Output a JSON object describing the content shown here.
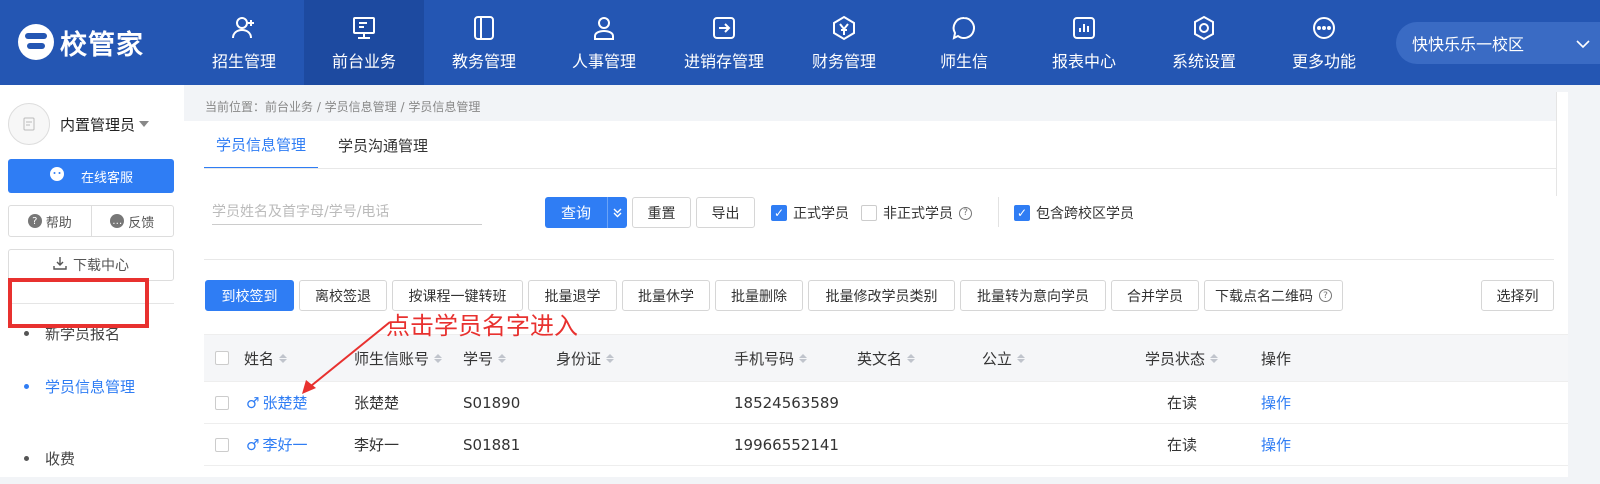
{
  "app": {
    "logo_text": "校管家"
  },
  "nav": {
    "items": [
      {
        "label": "招生管理",
        "icon": "user-add-icon"
      },
      {
        "label": "前台业务",
        "icon": "desk-icon",
        "active": true
      },
      {
        "label": "教务管理",
        "icon": "book-icon"
      },
      {
        "label": "人事管理",
        "icon": "person-icon"
      },
      {
        "label": "进销存管理",
        "icon": "inventory-icon"
      },
      {
        "label": "财务管理",
        "icon": "finance-icon"
      },
      {
        "label": "师生信",
        "icon": "message-icon"
      },
      {
        "label": "报表中心",
        "icon": "report-icon"
      },
      {
        "label": "系统设置",
        "icon": "settings-icon"
      },
      {
        "label": "更多功能",
        "icon": "more-icon"
      }
    ],
    "campus": "快快乐乐一校区"
  },
  "sidebar": {
    "username": "内置管理员",
    "service": "在线客服",
    "help": "帮助",
    "feedback": "反馈",
    "download": "下载中心",
    "items": [
      {
        "label": "新学员报名"
      },
      {
        "label": "学员信息管理",
        "active": true
      },
      {
        "label": "收费"
      }
    ]
  },
  "breadcrumb": "当前位置：前台业务 / 学员信息管理 / 学员信息管理",
  "tabs": [
    "学员信息管理",
    "学员沟通管理"
  ],
  "filter": {
    "search_placeholder": "学员姓名及首字母/学号/电话",
    "query": "查询",
    "reset": "重置",
    "export": "导出",
    "formal": "正式学员",
    "informal": "非正式学员",
    "cross_campus": "包含跨校区学员"
  },
  "actions": [
    "到校签到",
    "离校签退",
    "按课程一键转班",
    "批量退学",
    "批量休学",
    "批量删除",
    "批量修改学员类别",
    "批量转为意向学员",
    "合并学员",
    "下载点名二维码"
  ],
  "select_columns": "选择列",
  "table": {
    "headers": [
      "姓名",
      "师生信账号",
      "学号",
      "身份证",
      "手机号码",
      "英文名",
      "公立",
      "学员状态",
      "操作"
    ],
    "rows": [
      {
        "gender": "♂",
        "name": "张楚楚",
        "account": "张楚楚",
        "id": "S01890",
        "idcard": "",
        "phone": "18524563589",
        "en": "",
        "school": "",
        "status": "在读",
        "op": "操作"
      },
      {
        "gender": "♂",
        "name": "李好一",
        "account": "李好一",
        "id": "S01881",
        "idcard": "",
        "phone": "19966552141",
        "en": "",
        "school": "",
        "status": "在读",
        "op": "操作"
      }
    ]
  },
  "annotation": "点击学员名字进入",
  "colors": {
    "nav_bg": "#2456b3",
    "accent": "#2f7df4",
    "annotation": "#e8312f"
  }
}
